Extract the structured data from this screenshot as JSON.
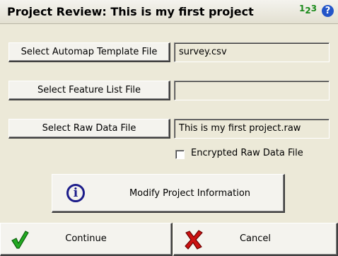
{
  "title": {
    "text": "Project Review: This is my first project",
    "ime_main": "1",
    "ime_sub": "2",
    "ime_tail": "3",
    "help": "?"
  },
  "automap": {
    "button": "Select Automap Template File",
    "value": "survey.csv"
  },
  "feature": {
    "button": "Select Feature List File",
    "value": ""
  },
  "rawdata": {
    "button": "Select Raw Data File",
    "value": "This is my first project.raw"
  },
  "encrypted": {
    "label": "Encrypted Raw Data File",
    "checked": false
  },
  "modify": {
    "label": "Modify Project Information",
    "icon": "i"
  },
  "footer": {
    "continue": "Continue",
    "cancel": "Cancel"
  },
  "colors": {
    "title_bg": "#e9e7dc",
    "help_icon": "#2355c8",
    "ime_green": "#1a8a1a",
    "check_green": "#22aa22",
    "cancel_red": "#cc1111",
    "info_blue": "#1c1c8a"
  }
}
